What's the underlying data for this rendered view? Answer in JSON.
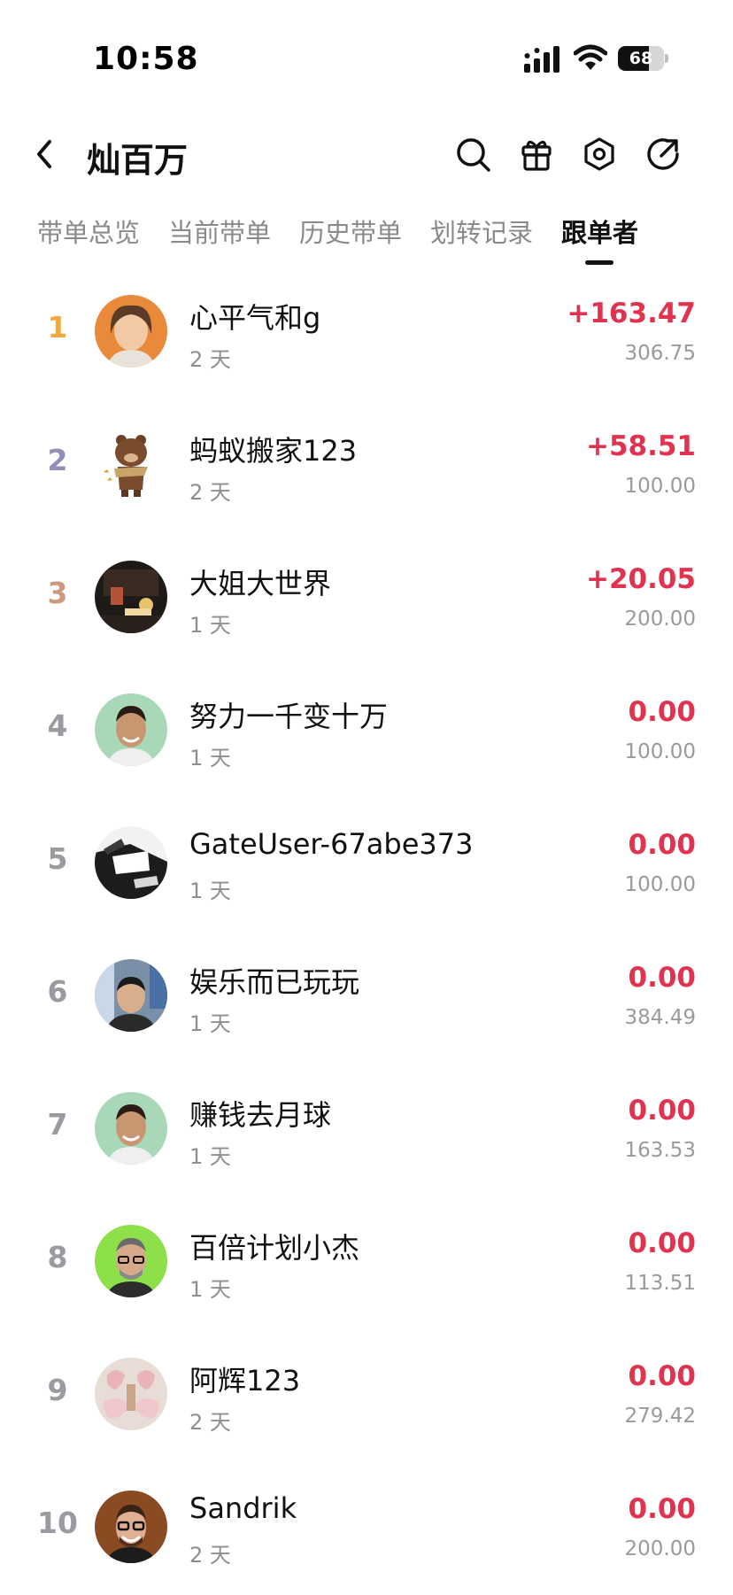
{
  "status": {
    "time": "10:58",
    "battery": "68",
    "battery_level": 0.68
  },
  "header": {
    "title": "灿百万",
    "icons": [
      "back-icon",
      "search-icon",
      "gift-icon",
      "settings-hexagon-icon",
      "share-icon"
    ]
  },
  "tabs": [
    {
      "label": "带单总览",
      "active": false
    },
    {
      "label": "当前带单",
      "active": false
    },
    {
      "label": "历史带单",
      "active": false
    },
    {
      "label": "划转记录",
      "active": false
    },
    {
      "label": "跟单者",
      "active": true
    }
  ],
  "colors": {
    "profit_red": "#e0334f",
    "rank_gold": "#f0a93a",
    "rank_silver": "#8f8fb8",
    "rank_bronze": "#c99a80",
    "rank_default": "#9a9aa0"
  },
  "followers": [
    {
      "rank": "1",
      "name": "心平气和g",
      "days": "2 天",
      "profit": "+163.47",
      "amount": "306.75"
    },
    {
      "rank": "2",
      "name": "蚂蚁搬家123",
      "days": "2 天",
      "profit": "+58.51",
      "amount": "100.00"
    },
    {
      "rank": "3",
      "name": "大姐大世界",
      "days": "1 天",
      "profit": "+20.05",
      "amount": "200.00"
    },
    {
      "rank": "4",
      "name": "努力一千变十万",
      "days": "1 天",
      "profit": "0.00",
      "amount": "100.00"
    },
    {
      "rank": "5",
      "name": "GateUser-67abe373",
      "days": "1 天",
      "profit": "0.00",
      "amount": "100.00"
    },
    {
      "rank": "6",
      "name": "娱乐而已玩玩",
      "days": "1 天",
      "profit": "0.00",
      "amount": "384.49"
    },
    {
      "rank": "7",
      "name": "赚钱去月球",
      "days": "1 天",
      "profit": "0.00",
      "amount": "163.53"
    },
    {
      "rank": "8",
      "name": "百倍计划小杰",
      "days": "1 天",
      "profit": "0.00",
      "amount": "113.51"
    },
    {
      "rank": "9",
      "name": "阿辉123",
      "days": "2 天",
      "profit": "0.00",
      "amount": "279.42"
    },
    {
      "rank": "10",
      "name": "Sandrik",
      "days": "2 天",
      "profit": "0.00",
      "amount": "200.00"
    }
  ]
}
